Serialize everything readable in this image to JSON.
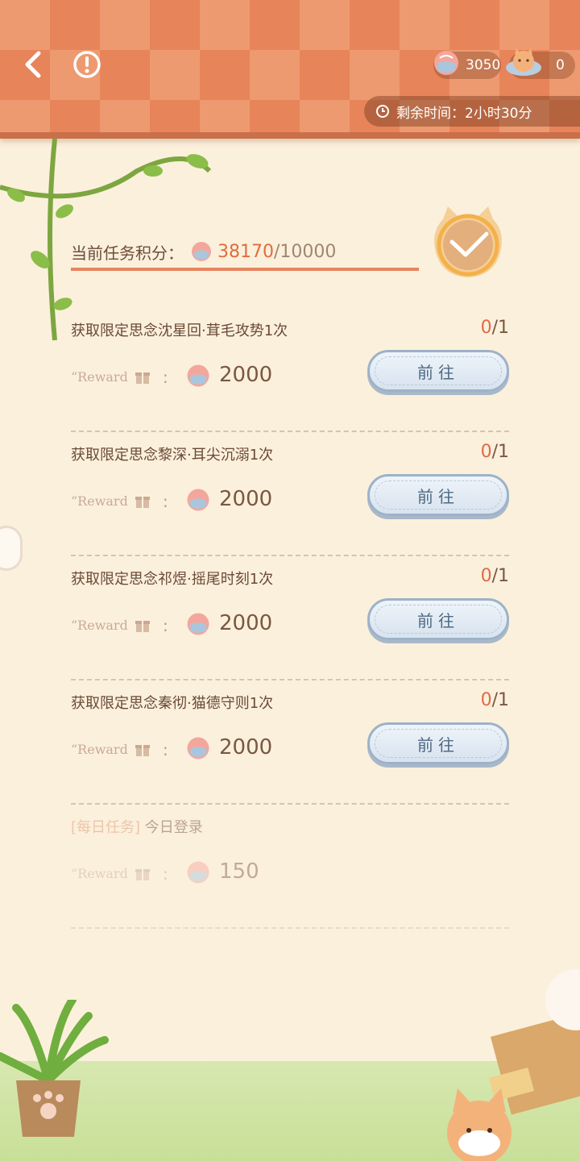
{
  "header": {
    "currencies": [
      {
        "name": "shell-coin",
        "value": "3050"
      },
      {
        "name": "cat-token",
        "value": "0"
      }
    ],
    "timer_text": "剩余时间：2小时30分"
  },
  "score": {
    "label": "当前任务积分：",
    "current": "38170",
    "sep": "/",
    "max": "10000"
  },
  "tasks": [
    {
      "title": "获取限定思念沈星回·茸毛攻势1次",
      "done": "0",
      "total": "1",
      "reward_label": "“Reward",
      "colon": ":",
      "reward": "2000",
      "button": "前往"
    },
    {
      "title": "获取限定思念黎深·耳尖沉溺1次",
      "done": "0",
      "total": "1",
      "reward_label": "“Reward",
      "colon": ":",
      "reward": "2000",
      "button": "前往"
    },
    {
      "title": "获取限定思念祁煜·摇尾时刻1次",
      "done": "0",
      "total": "1",
      "reward_label": "“Reward",
      "colon": ":",
      "reward": "2000",
      "button": "前往"
    },
    {
      "title": "获取限定思念秦彻·猫德守则1次",
      "done": "0",
      "total": "1",
      "reward_label": "“Reward",
      "colon": ":",
      "reward": "2000",
      "button": "前往"
    }
  ],
  "daily": {
    "tag": "[每日任务]",
    "title": "今日登录",
    "reward_label": "“Reward",
    "colon": ":",
    "reward": "150"
  },
  "colors": {
    "accent": "#e46b3d",
    "header": "#ee9a70",
    "button_border": "#9db2c8"
  }
}
